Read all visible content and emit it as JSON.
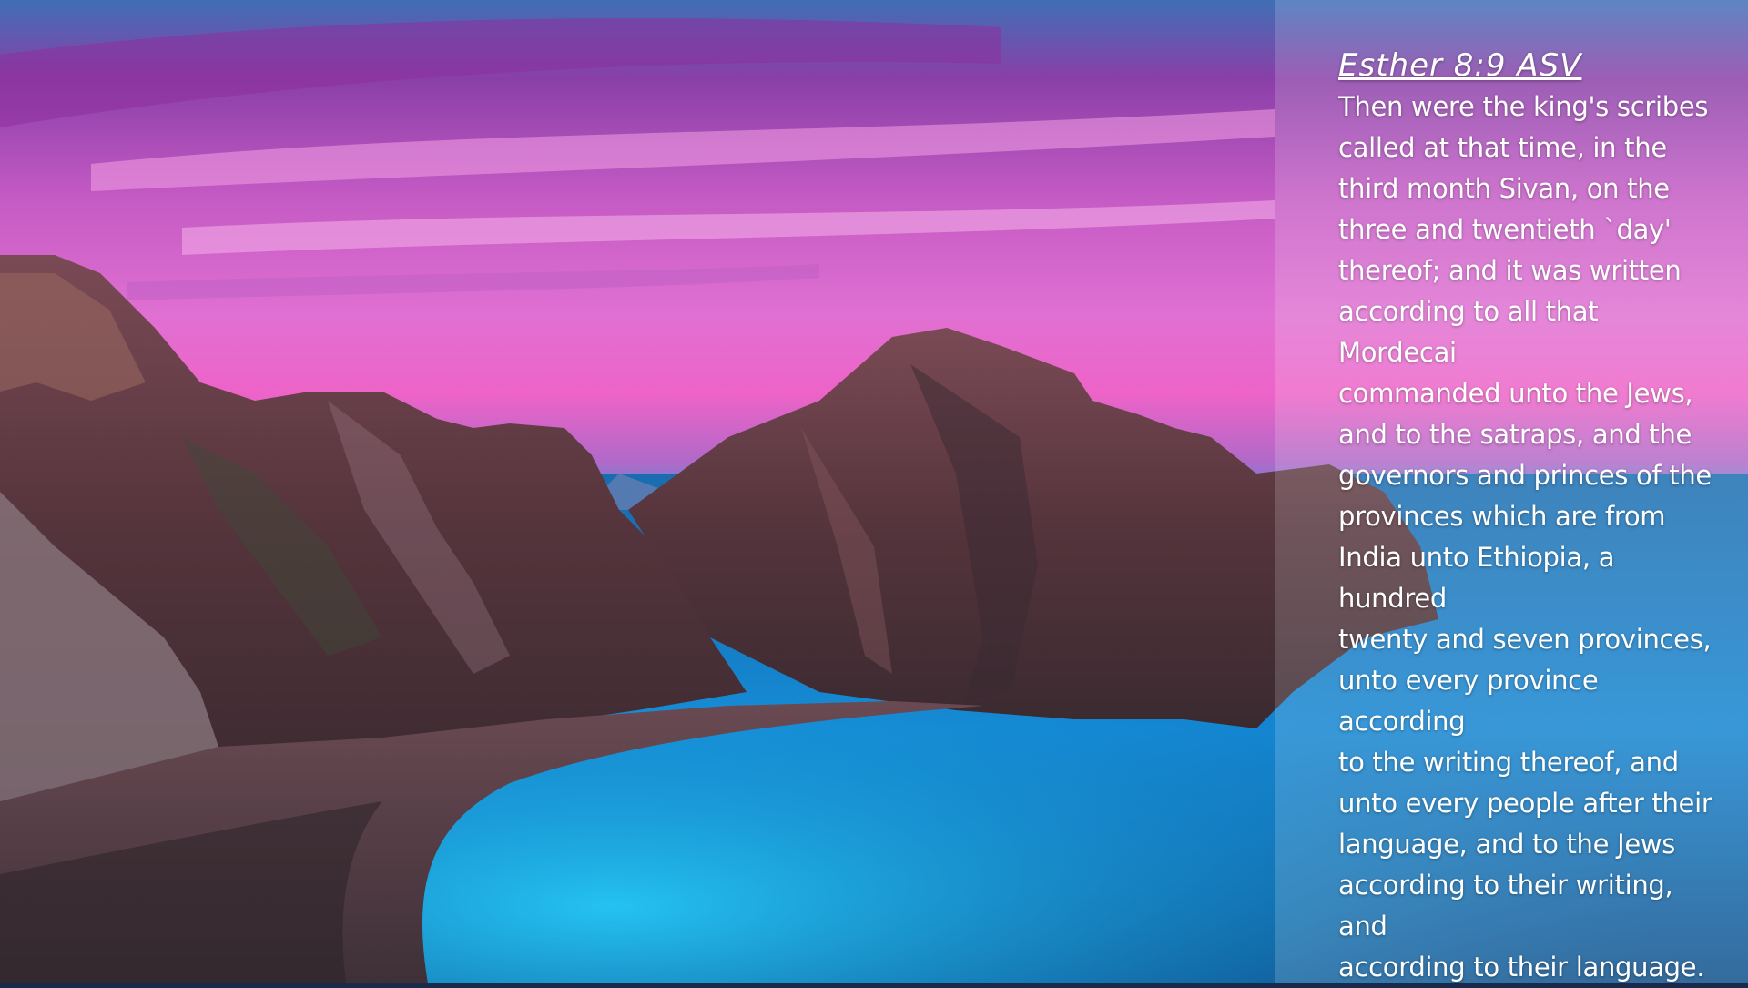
{
  "verse": {
    "reference": "Esther 8:9 ASV",
    "lines": [
      "Then were the king's scribes",
      "called at that time, in the",
      "third month Sivan, on the",
      "three and twentieth `day'",
      "thereof; and it was written",
      "according to all that Mordecai",
      "commanded unto the Jews,",
      "and to the satraps, and the",
      "governors and princes of the",
      "provinces which are from",
      "India unto Ethiopia, a hundred",
      "twenty and seven provinces,",
      "unto every province according",
      "to the writing thereof, and",
      "unto every people after their",
      "language, and to the Jews",
      "according to their writing, and",
      "according to their language."
    ]
  },
  "background": {
    "sky_colors": [
      "#7a3f9e",
      "#e055c8",
      "#f07ad6",
      "#4aa7e0"
    ],
    "sea_color": "#1279c7",
    "cliff_color": "#5a3a40",
    "panel_tint": "#ffffff"
  }
}
